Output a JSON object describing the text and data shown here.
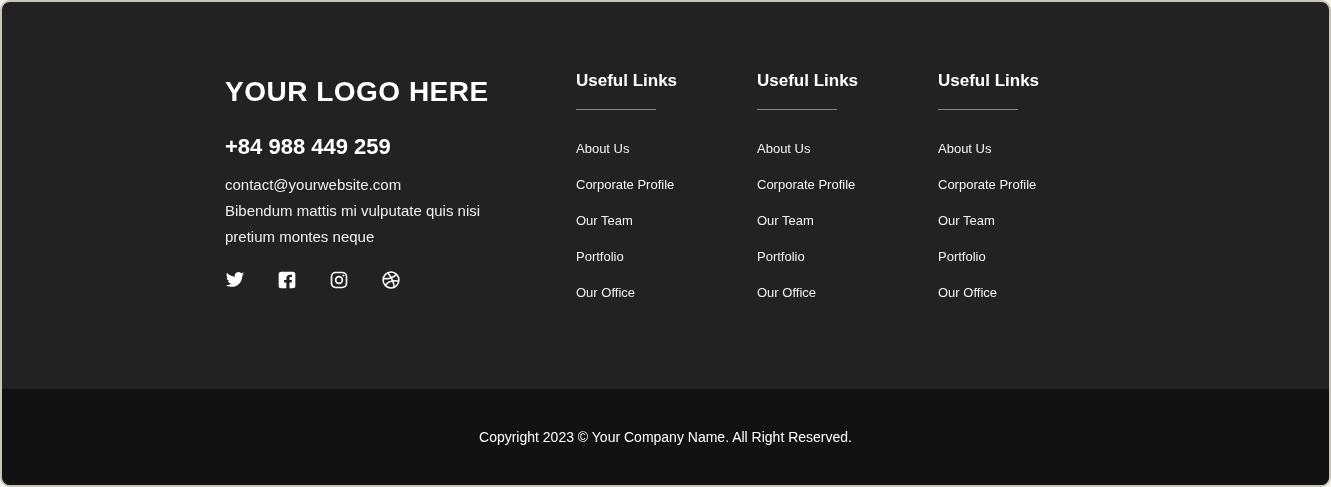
{
  "brand": {
    "logo": "YOUR LOGO HERE",
    "phone": "+84 988 449 259",
    "email": "contact@yourwebsite.com",
    "description": "Bibendum mattis mi vulputate quis nisi pretium montes neque"
  },
  "social": [
    {
      "kind": "bird"
    },
    {
      "kind": "f-square"
    },
    {
      "kind": "camera"
    },
    {
      "kind": "ball"
    }
  ],
  "link_columns": [
    {
      "heading": "Useful Links",
      "links": [
        "About Us",
        "Corporate Profile",
        "Our Team",
        "Portfolio",
        "Our Office"
      ]
    },
    {
      "heading": "Useful Links",
      "links": [
        "About Us",
        "Corporate Profile",
        "Our Team",
        "Portfolio",
        "Our Office"
      ]
    },
    {
      "heading": "Useful Links",
      "links": [
        "About Us",
        "Corporate Profile",
        "Our Team",
        "Portfolio",
        "Our Office"
      ]
    }
  ],
  "copyright": "Copyright 2023 © Your Company Name. All Right Reserved."
}
